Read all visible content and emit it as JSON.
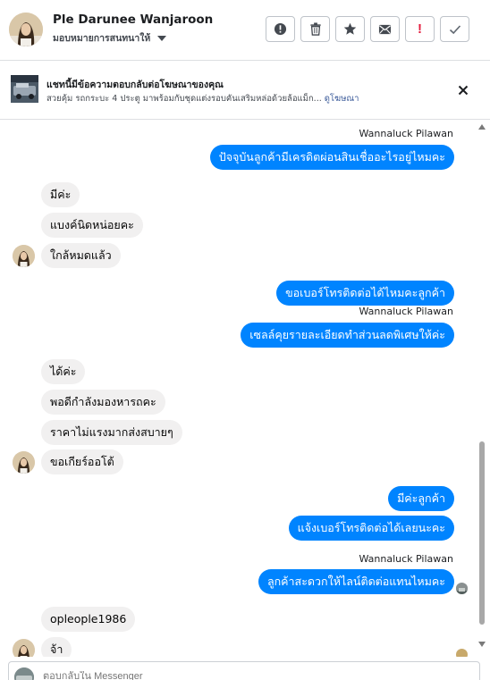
{
  "header": {
    "contact_name": "Ple Darunee Wanjaroon",
    "assignee_label": "มอบหมายการสนทนาให้",
    "toolbar": [
      {
        "name": "spam-button",
        "icon": "alert-circle-icon"
      },
      {
        "name": "delete-button",
        "icon": "trash-icon"
      },
      {
        "name": "star-button",
        "icon": "star-icon"
      },
      {
        "name": "mark-unread-button",
        "icon": "envelope-icon"
      },
      {
        "name": "important-button",
        "icon": "exclamation-icon"
      },
      {
        "name": "done-button",
        "icon": "check-icon"
      }
    ]
  },
  "ad": {
    "title": "แชทนี้มีข้อความตอบกลับต่อโฆษณาของคุณ",
    "description": "สวยคุ้ม รถกระบะ 4 ประตู มาพร้อมกับชุดแต่งรอบคันเสริมหล่อด้วยล้อแม็ก...",
    "link_label": "ดูโฆษณา"
  },
  "messages": {
    "sender_1": "Wannaluck Pilawan",
    "m1": "ปัจจุบันลูกค้ามีเครดิตผ่อนสินเชื่ออะไรอยู่ไหมคะ",
    "m2": "มีค่ะ",
    "m3": "แบงค์นิดหน่อยคะ",
    "m4": "ใกล้หมดแล้ว",
    "m5": "ขอเบอร์โทรติดต่อได้ไหมคะลูกค้า",
    "sender_2": "Wannaluck Pilawan",
    "m6": "เซลล์คุยรายละเอียดทำส่วนลดพิเศษให้ค่ะ",
    "m7": "ได้ค่ะ",
    "m8": "พอดีกำลังมองหารถคะ",
    "m9": "ราคาไม่แรงมากส่งสบายๆ",
    "m10": "ขอเกียร์ออโต้",
    "m11": "มีค่ะลูกค้า",
    "m12": "แจ้งเบอร์โทรติดต่อได้เลยนะคะ",
    "sender_3": "Wannaluck Pilawan",
    "m13": "ลูกค้าสะดวกให้ไลน์ติดต่อแทนไหมคะ",
    "m14": "opleople1986",
    "m15": "จ้า"
  },
  "composer": {
    "placeholder": "ตอบกลับใน Messenger"
  },
  "colors": {
    "outgoing_bubble": "#0084ff",
    "incoming_bubble": "#f1f0f0",
    "important_red": "#e41e3f"
  }
}
